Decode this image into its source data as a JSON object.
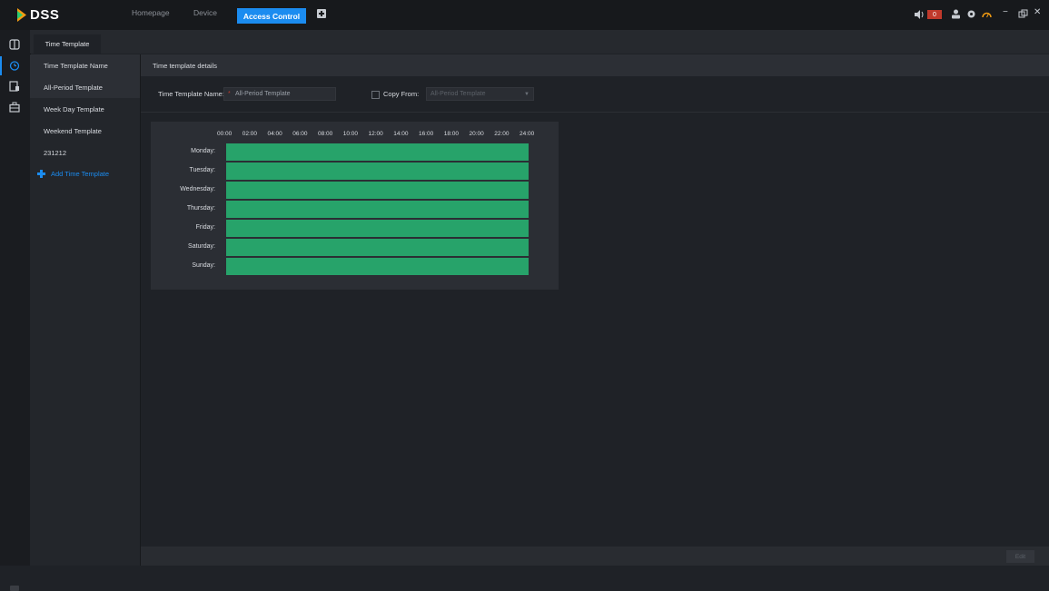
{
  "app": {
    "name": "DSS"
  },
  "nav": {
    "homepage": "Homepage",
    "device": "Device",
    "access_control": "Access Control"
  },
  "topbar": {
    "alarm_count": "0"
  },
  "tabs": [
    {
      "label": "Time Template"
    }
  ],
  "list": {
    "header": "Time Template Name",
    "items": [
      "All-Period Template",
      "Week Day Template",
      "Weekend Template",
      "231212"
    ],
    "add_label": "Add Time Template"
  },
  "details": {
    "header": "Time template details",
    "name_label": "Time Template Name:",
    "name_value": "All-Period Template",
    "copy_from_label": "Copy From:",
    "copy_from_value": "All-Period Template"
  },
  "schedule": {
    "hours": [
      "00:00",
      "02:00",
      "04:00",
      "06:00",
      "08:00",
      "10:00",
      "12:00",
      "14:00",
      "16:00",
      "18:00",
      "20:00",
      "22:00",
      "24:00"
    ],
    "days": [
      "Monday:",
      "Tuesday:",
      "Wednesday:",
      "Thursday:",
      "Friday:",
      "Saturday:",
      "Sunday:"
    ],
    "active_color": "#27a36a"
  },
  "footer": {
    "edit_label": "Edit"
  }
}
